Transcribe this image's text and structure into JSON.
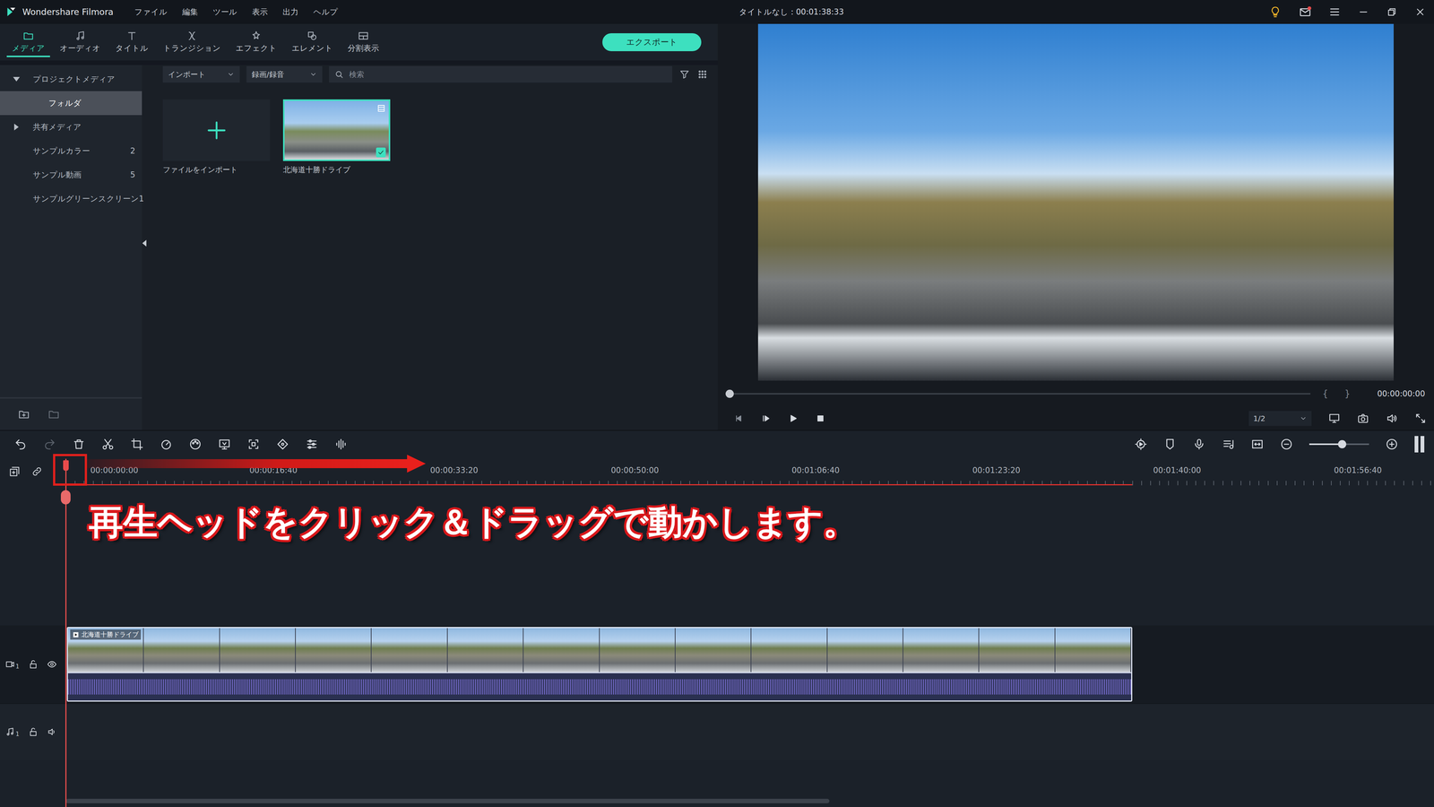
{
  "window": {
    "app_name": "Wondershare Filmora",
    "title": "タイトルなし : 00:01:38:33"
  },
  "menu": [
    "ファイル",
    "編集",
    "ツール",
    "表示",
    "出力",
    "ヘルプ"
  ],
  "notifications": {
    "unread": true
  },
  "tabs": [
    {
      "label": "メディア",
      "selected": true
    },
    {
      "label": "オーディオ",
      "selected": false
    },
    {
      "label": "タイトル",
      "selected": false
    },
    {
      "label": "トランジション",
      "selected": false
    },
    {
      "label": "エフェクト",
      "selected": false
    },
    {
      "label": "エレメント",
      "selected": false
    },
    {
      "label": "分割表示",
      "selected": false
    }
  ],
  "export_button": "エクスポート",
  "sidebar": {
    "items": [
      {
        "label": "プロジェクトメディア",
        "kind": "group",
        "expanded": true,
        "selected": false
      },
      {
        "label": "フォルダ",
        "kind": "folder",
        "selected": true
      },
      {
        "label": "共有メディア",
        "kind": "group",
        "expanded": false,
        "selected": false
      },
      {
        "label": "サンプルカラー",
        "kind": "sample",
        "count": "2",
        "selected": false
      },
      {
        "label": "サンプル動画",
        "kind": "sample",
        "count": "5",
        "selected": false
      },
      {
        "label": "サンプルグリーンスクリーン",
        "kind": "sample",
        "count": "1",
        "selected": false
      }
    ]
  },
  "media": {
    "import_dropdown": "インポート",
    "record_dropdown": "録画/録音",
    "search": {
      "placeholder": "検索"
    },
    "items": [
      {
        "label": "ファイルをインポート",
        "kind": "import",
        "selected": false
      },
      {
        "label": "北海道十勝ドライブ",
        "kind": "clip",
        "selected": true,
        "in_timeline": true
      }
    ]
  },
  "preview": {
    "progress": {
      "level": 0
    },
    "mark_in": "{",
    "mark_out": "}",
    "time": "00:00:00:00",
    "quality": "1/2"
  },
  "timeline": {
    "history": {
      "undo_enabled": true,
      "redo_enabled": false
    },
    "zoom": {
      "level": 0.55
    },
    "ruler": [
      "00:00:00:00",
      "00:00:16:40",
      "00:00:33:20",
      "00:00:50:00",
      "00:01:06:40",
      "00:01:23:20",
      "00:01:40:00",
      "00:01:56:40"
    ],
    "tracks": [
      {
        "kind": "video",
        "number": "1",
        "locked": false,
        "visible": true,
        "clips": [
          {
            "label": "北海道十勝ドライブ",
            "selected": true
          }
        ]
      },
      {
        "kind": "audio",
        "number": "1",
        "locked": false,
        "muted": false,
        "clips": []
      }
    ]
  },
  "annotation": {
    "text": "再生ヘッドをクリック＆ドラッグで動かします。"
  }
}
